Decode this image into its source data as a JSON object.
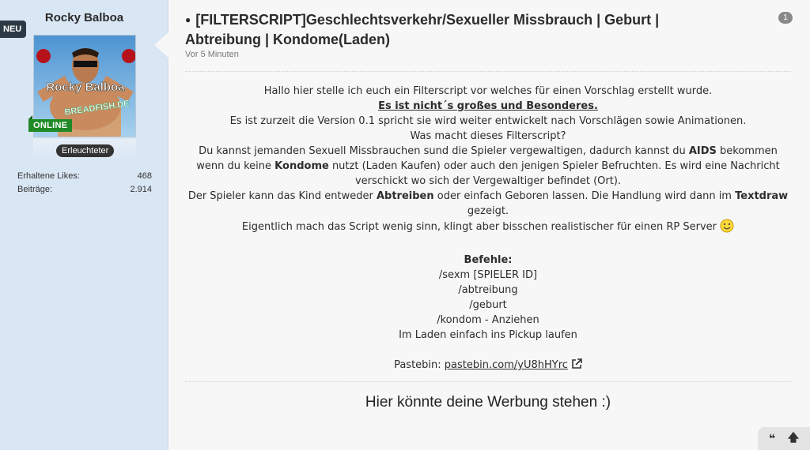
{
  "badge_new": "NEU",
  "author": {
    "name": "Rocky Balboa",
    "avatar_text": "Rocky Balboa",
    "avatar_watermark": "BREADFISH.DE",
    "status": "ONLINE",
    "rank": "Erleuchteter",
    "stats": [
      {
        "label": "Erhaltene Likes:",
        "value": "468"
      },
      {
        "label": "Beiträge:",
        "value": "2.914"
      }
    ]
  },
  "post": {
    "title": "[FILTERSCRIPT]Geschlechtsverkehr/Sexueller Missbrauch | Geburt | Abtreibung | Kondome(Laden)",
    "time": "Vor 5 Minuten",
    "reply_count": "1",
    "lines": {
      "l1": "Hallo hier stelle ich euch ein Filterscript vor welches für einen Vorschlag erstellt wurde.",
      "l2": "Es ist nicht´s großes und Besonderes.",
      "l3": "Es ist zurzeit die Version 0.1 spricht sie wird weiter entwickelt nach Vorschlägen sowie Animationen.",
      "l4": "Was macht dieses Filterscript?",
      "l5a": "Du kannst jemanden Sexuell Missbrauchen sund die Spieler vergewaltigen, dadurch kannst du ",
      "l5b": "AIDS",
      "l5c": " bekommen wenn du keine ",
      "l5d": "Kondome",
      "l5e": " nutzt (Laden Kaufen) oder auch den jenigen Spieler Befruchten. Es wird eine Nachricht verschickt wo sich der Vergewaltiger befindet (Ort).",
      "l6a": "Der Spieler kann das Kind entweder ",
      "l6b": "Abtreiben",
      "l6c": " oder einfach Geboren lassen. Die Handlung wird dann im ",
      "l6d": "Textdraw",
      "l6e": " gezeigt.",
      "l7": "Eigentlich mach das Script wenig sinn, klingt aber bisschen realistischer für einen RP Server",
      "commands_title": "Befehle:",
      "commands": [
        "/sexm [SPIELER ID]",
        "/abtreibung",
        "/geburt",
        "/kondom - Anziehen",
        "Im Laden einfach ins Pickup laufen"
      ],
      "pastebin_label": "Pastebin: ",
      "pastebin_link": "pastebin.com/yU8hHYrc"
    },
    "signature": "Hier könnte deine Werbung stehen :)"
  },
  "colors": {
    "online": "#1f8a25",
    "sidebar": "#d9e6f4",
    "main_bg": "#f7f7f7"
  },
  "icons": {
    "quote": "quote-icon",
    "top": "arrow-up-icon",
    "smiley": "smiley-icon",
    "external": "external-link-icon"
  }
}
